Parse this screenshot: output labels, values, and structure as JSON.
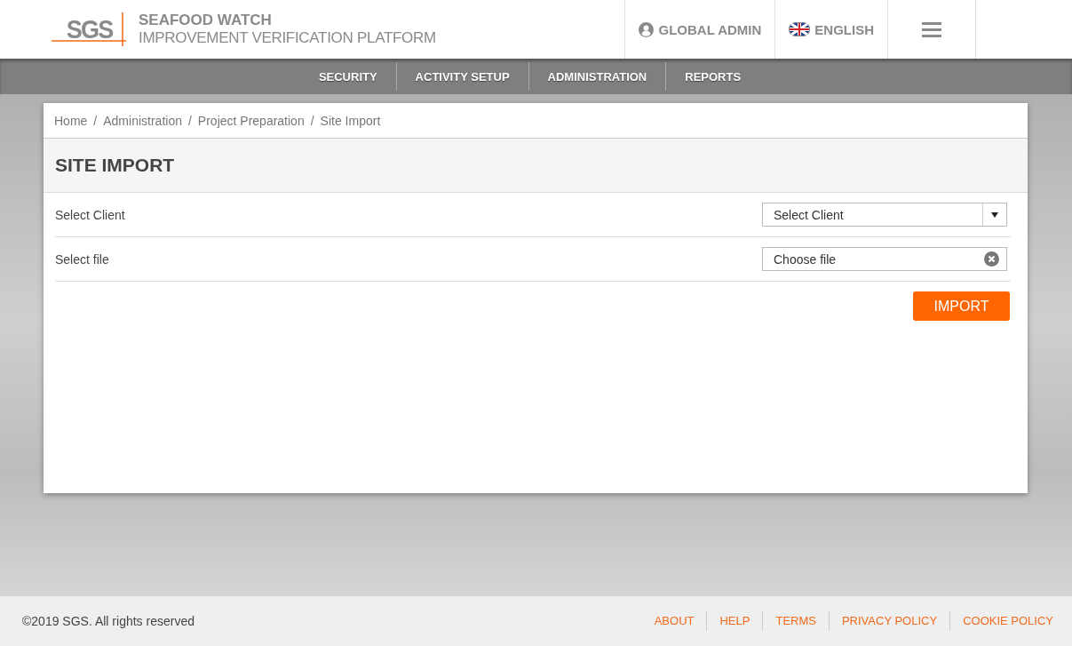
{
  "header": {
    "logo": "SGS",
    "title": "SEAFOOD WATCH",
    "subtitle": "IMPROVEMENT VERIFICATION PLATFORM",
    "user": "GLOBAL ADMIN",
    "language": "ENGLISH"
  },
  "nav": [
    "SECURITY",
    "ACTIVITY SETUP",
    "ADMINISTRATION",
    "REPORTS"
  ],
  "breadcrumb": [
    {
      "label": "Home"
    },
    {
      "separator": "/",
      "label": "Administration"
    },
    {
      "separator": "/",
      "label": "Project Preparation"
    },
    {
      "separator": "/",
      "label": "Site Import"
    }
  ],
  "page_title": "SITE IMPORT",
  "form": [
    {
      "kind": "select",
      "label": "Select Client",
      "placeholder": "Select Client"
    },
    {
      "kind": "file",
      "label": "Select file",
      "placeholder": "Choose file"
    }
  ],
  "import_button": "IMPORT",
  "footer": {
    "copyright": "©2019 SGS. All rights reserved",
    "links": [
      "ABOUT",
      "HELP",
      "TERMS",
      "PRIVACY POLICY",
      "COOKIE POLICY"
    ]
  }
}
